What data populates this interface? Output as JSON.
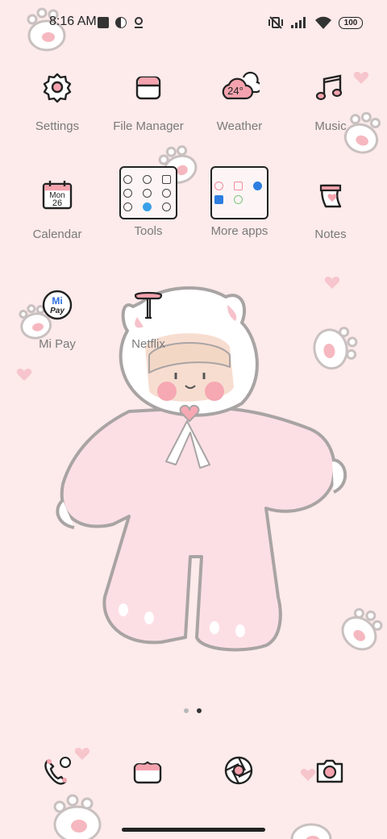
{
  "status_bar": {
    "time": "8:16 AM",
    "battery": "100"
  },
  "apps_row1": [
    {
      "label": "Settings"
    },
    {
      "label": "File Manager"
    },
    {
      "label": "Weather",
      "temp": "24°"
    },
    {
      "label": "Music"
    }
  ],
  "apps_row2": [
    {
      "label": "Calendar",
      "day": "Mon",
      "date": "26"
    },
    {
      "label": "Tools"
    },
    {
      "label": "More apps"
    },
    {
      "label": "Notes"
    }
  ],
  "apps_row3": [
    {
      "label": "Mi Pay",
      "icon_text_top": "Mi",
      "icon_text_bottom": "Pay"
    },
    {
      "label": "Netflix"
    }
  ],
  "page_indicator": {
    "pages": 2,
    "current": 2
  },
  "dock": [
    "phone-icon",
    "messages-icon",
    "browser-icon",
    "camera-icon"
  ],
  "colors": {
    "background": "#fdeaea",
    "accent_pink": "#f4a3ae",
    "outline": "#222222"
  }
}
